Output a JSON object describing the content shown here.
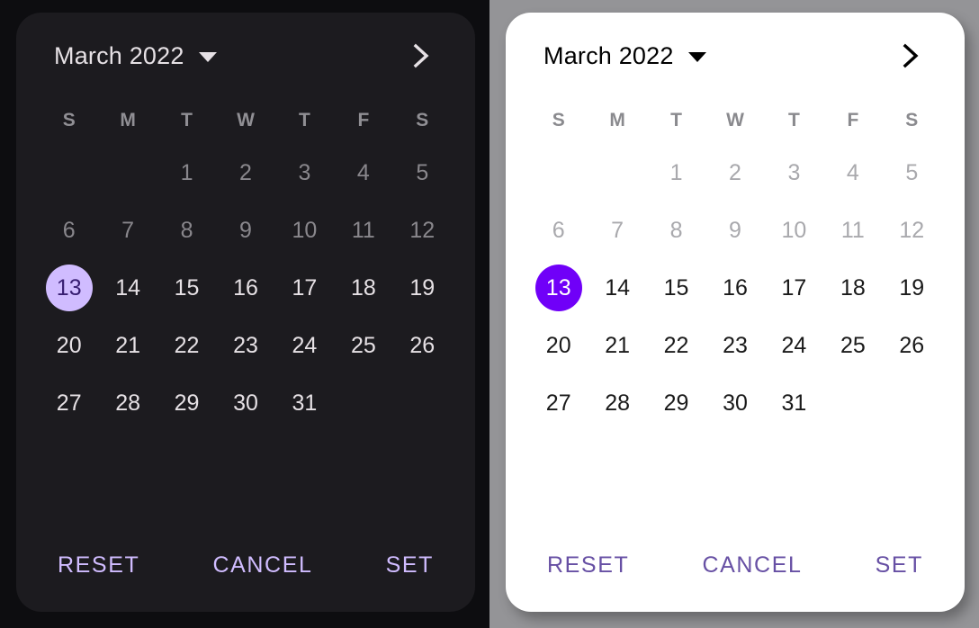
{
  "panels": [
    {
      "theme": "dark",
      "header": {
        "month_label": "March 2022",
        "caret_icon": "chevron-down-icon",
        "next_icon": "chevron-right-icon"
      },
      "weekdays": [
        "S",
        "M",
        "T",
        "W",
        "T",
        "F",
        "S"
      ],
      "actions": {
        "reset_label": "RESET",
        "cancel_label": "CANCEL",
        "set_label": "SET"
      },
      "colors": {
        "surface": "#1C1B1F",
        "backdrop": "#0D0D10",
        "on_surface": "#E6E1E5",
        "disabled": "#89878C",
        "weekday": "#908F94",
        "accent": "#D0BCFF",
        "on_accent": "#381E72",
        "action": "#D0BCFF"
      }
    },
    {
      "theme": "light",
      "header": {
        "month_label": "March 2022",
        "caret_icon": "chevron-down-icon",
        "next_icon": "chevron-right-icon"
      },
      "weekdays": [
        "S",
        "M",
        "T",
        "W",
        "T",
        "F",
        "S"
      ],
      "actions": {
        "reset_label": "RESET",
        "cancel_label": "CANCEL",
        "set_label": "SET"
      },
      "colors": {
        "surface": "#FFFFFF",
        "backdrop": "#949497",
        "on_surface": "#1A1A1A",
        "disabled": "#A9A9AD",
        "weekday": "#8A8A8E",
        "accent": "#7000F8",
        "on_accent": "#FFFFFF",
        "action": "#6750A4"
      }
    }
  ],
  "calendar": {
    "month": "March",
    "year": "2022",
    "selected_day": 13,
    "leading_blanks": 2,
    "weeks": [
      [
        null,
        null,
        1,
        2,
        3,
        4,
        5
      ],
      [
        6,
        7,
        8,
        9,
        10,
        11,
        12
      ],
      [
        13,
        14,
        15,
        16,
        17,
        18,
        19
      ],
      [
        20,
        21,
        22,
        23,
        24,
        25,
        26
      ],
      [
        27,
        28,
        29,
        30,
        31,
        null,
        null
      ]
    ],
    "disabled_days": [
      1,
      2,
      3,
      4,
      5,
      6,
      7,
      8,
      9,
      10,
      11,
      12
    ],
    "enabled_days": [
      13,
      14,
      15,
      16,
      17,
      18,
      19,
      20,
      21,
      22,
      23,
      24,
      25,
      26,
      27,
      28,
      29,
      30,
      31
    ]
  }
}
